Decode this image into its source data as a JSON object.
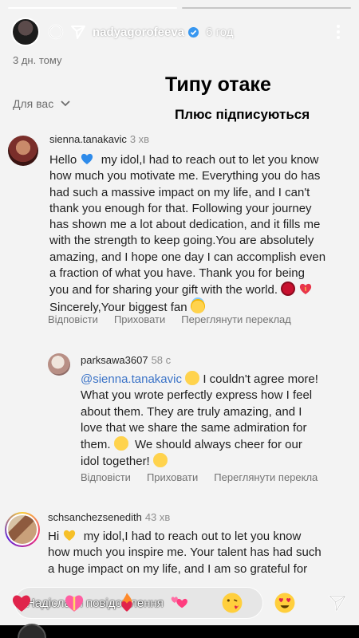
{
  "story": {
    "progress": [
      1,
      0
    ],
    "username": "nadyagorofeeva",
    "time": "6 год",
    "date": "3 дн. тому"
  },
  "overlay": {
    "title": "Типу отаке",
    "subtitle": "Плюс підписуються"
  },
  "filter": {
    "label": "Для вас"
  },
  "comments": [
    {
      "username": "sienna.tanakavic",
      "time": "3 хв",
      "lines": [
        "Hello",
        "how much you motivate me. Everything you do has",
        "had such a massive impact on my life, and I can't",
        "thank you enough for that. Following your journey",
        "has shown me a lot about dedication, and it fills me",
        "with the strength to keep going.You are absolutely",
        "amazing, and I hope one day I can accomplish even",
        "a fraction of what you have. Thank you for being",
        "you and for sharing your gift with the world.",
        "Sincerely,Your biggest fan"
      ],
      "line1_rest": "my idol,I had to reach out to let you know",
      "reply": "Відповісти",
      "hide": "Приховати",
      "translate": "Переглянути переклад"
    },
    {
      "username": "parksawa3607",
      "time": "58 с",
      "mention": "@sienna.tanakavic",
      "lines": [
        "I couldn't agree more!",
        "What you wrote perfectly express how I feel",
        "about them. They are truly amazing, and I",
        "love that we share the same admiration for",
        "them.",
        "We should always cheer for our",
        "idol together!"
      ],
      "reply": "Відповісти",
      "hide": "Приховати",
      "translate": "Переглянути перекла"
    },
    {
      "username": "schsanchezsenedith",
      "time": "43 хв",
      "lines": [
        "Hi",
        "my idol,I had to reach out to let you know",
        "how much you inspire me. Your talent has had such",
        "a huge impact on my life, and I am so grateful for"
      ]
    }
  ],
  "message_input": {
    "placeholder": "Надіслати повідомлення"
  },
  "icons": {
    "header": [
      "circle-icon",
      "send-icon",
      "verified-badge-icon",
      "more-vertical-icon",
      "chevron-down-icon"
    ],
    "reactions": [
      "red-heart-emoji",
      "heart-gift-emoji",
      "heart-fire-emoji",
      "revolving-hearts-emoji",
      "kiss-face-emoji",
      "heart-eyes-emoji",
      "send-icon"
    ]
  },
  "colors": {
    "background": "#f3f3f3",
    "mention": "#3b73c7",
    "verified": "#3897f0"
  }
}
